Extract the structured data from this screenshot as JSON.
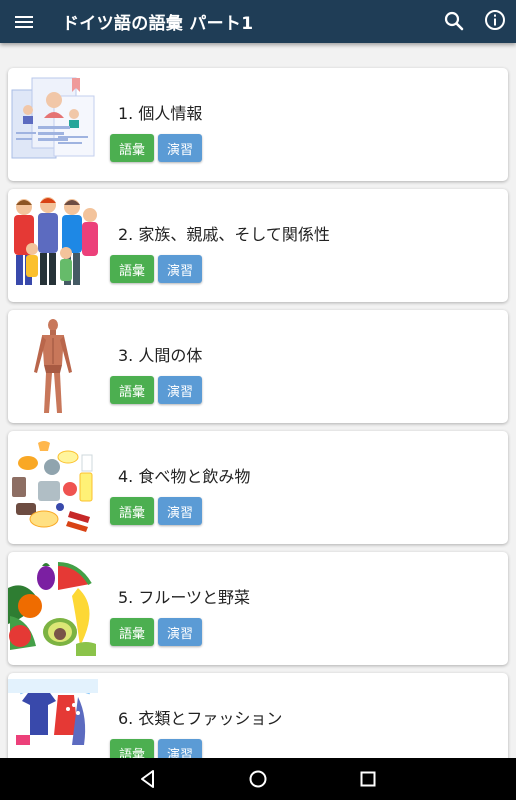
{
  "app": {
    "title": "ドイツ語の語彙 パート1"
  },
  "lessons": [
    {
      "label": "1. 個人情報",
      "vocab": "語彙",
      "drill": "演習",
      "icon": "personal-info-illustration"
    },
    {
      "label": "2. 家族、親戚、そして関係性",
      "vocab": "語彙",
      "drill": "演習",
      "icon": "family-illustration"
    },
    {
      "label": "3. 人間の体",
      "vocab": "語彙",
      "drill": "演習",
      "icon": "human-body-illustration"
    },
    {
      "label": "4. 食べ物と飲み物",
      "vocab": "語彙",
      "drill": "演習",
      "icon": "food-drink-illustration"
    },
    {
      "label": "5. フルーツと野菜",
      "vocab": "語彙",
      "drill": "演習",
      "icon": "fruit-vegetable-illustration"
    },
    {
      "label": "6. 衣類とファッション",
      "vocab": "語彙",
      "drill": "演習",
      "icon": "clothing-illustration"
    }
  ],
  "colors": {
    "appbar": "#1f3d56",
    "vocab_button": "#4caf50",
    "drill_button": "#5b9bd5"
  },
  "navbar": {
    "back": "back-icon",
    "home": "home-icon",
    "recents": "recents-icon"
  }
}
